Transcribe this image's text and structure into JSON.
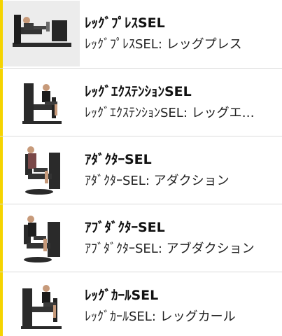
{
  "accent_color": "#f5d400",
  "items": [
    {
      "title": "ﾚｯｸﾞﾌﾟﾚｽSEL",
      "subtitle": "ﾚｯｸﾞﾌﾟﾚｽSEL: レッグプレス",
      "image": "leg-press-machine"
    },
    {
      "title": "ﾚｯｸﾞｴｸｽﾃﾝｼｮﾝSEL",
      "subtitle": "ﾚｯｸﾞｴｸｽﾃﾝｼｮﾝSEL: レッグエ…",
      "image": "leg-extension-machine"
    },
    {
      "title": "ｱﾀﾞｸﾀｰSEL",
      "subtitle": "ｱﾀﾞｸﾀｰSEL: アダクション",
      "image": "adductor-machine"
    },
    {
      "title": "ｱﾌﾞﾀﾞｸﾀｰSEL",
      "subtitle": "ｱﾌﾞﾀﾞｸﾀｰSEL: アブダクション",
      "image": "abductor-machine"
    },
    {
      "title": "ﾚｯｸﾞｶｰﾙSEL",
      "subtitle": "ﾚｯｸﾞｶｰﾙSEL: レッグカール",
      "image": "leg-curl-machine"
    }
  ]
}
